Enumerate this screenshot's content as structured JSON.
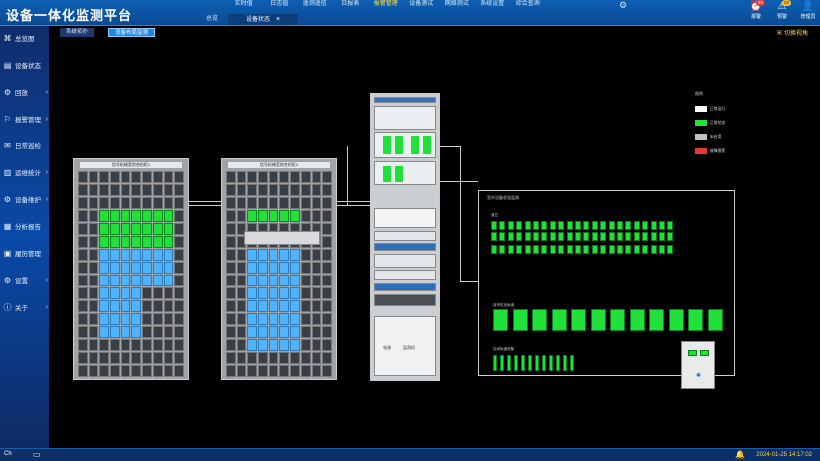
{
  "app": {
    "title": "设备一体化监测平台"
  },
  "topnav": [
    "实时值",
    "日志值",
    "遥测遥信",
    "日报表",
    "报警管理",
    "设备测试",
    "网络测试",
    "系统设置",
    "综合查询"
  ],
  "topnav_active": 4,
  "tabs": [
    {
      "label": "总览"
    },
    {
      "label": "设备状态",
      "active": true,
      "close": "×"
    }
  ],
  "header_icons": [
    {
      "name": "alarm",
      "label": "报警",
      "badge": "29"
    },
    {
      "name": "warn",
      "label": "预警",
      "badge": "20"
    },
    {
      "name": "user",
      "label": "管理员",
      "badge": ""
    }
  ],
  "sidebar": [
    {
      "icon": "⌘",
      "label": "总览图",
      "arrow": false
    },
    {
      "icon": "▤",
      "label": "设备状态",
      "arrow": false
    },
    {
      "icon": "⚙",
      "label": "回放",
      "arrow": true
    },
    {
      "icon": "⚐",
      "label": "报警管理",
      "arrow": true
    },
    {
      "icon": "✉",
      "label": "日常巡检",
      "arrow": false
    },
    {
      "icon": "▥",
      "label": "运维统计",
      "arrow": true
    },
    {
      "icon": "⚙",
      "label": "设备维护",
      "arrow": true
    },
    {
      "icon": "▦",
      "label": "分析报告",
      "arrow": false
    },
    {
      "icon": "▣",
      "label": "履历管理",
      "arrow": false
    },
    {
      "icon": "⚙",
      "label": "设置",
      "arrow": true
    },
    {
      "icon": "ⓘ",
      "label": "关于",
      "arrow": true
    }
  ],
  "subtabs": [
    "系统拓扑",
    "设备布局监测"
  ],
  "switch_label": "切换视角",
  "racks": {
    "rack1_title": "信号机械室综合机柜1",
    "rack2_title": "信号机械室综合机柜2"
  },
  "cabinet_labels": {
    "power": "电源",
    "panel": "监测机"
  },
  "legend": {
    "header": "图例",
    "items": [
      {
        "label": "正常运行",
        "color": "#ffffff"
      },
      {
        "label": "正常状态",
        "color": "#22e03a"
      },
      {
        "label": "未启用",
        "color": "#c0c0c0"
      },
      {
        "label": "故障报警",
        "color": "#e53935"
      }
    ]
  },
  "netbox": {
    "title": "室外设备状态监测",
    "group1": "道岔",
    "group2": "信号机及轨道",
    "group3": "区间轨道设备"
  },
  "footer": {
    "left": "Ch",
    "datetime": "2024-01-25 14:17:02"
  }
}
